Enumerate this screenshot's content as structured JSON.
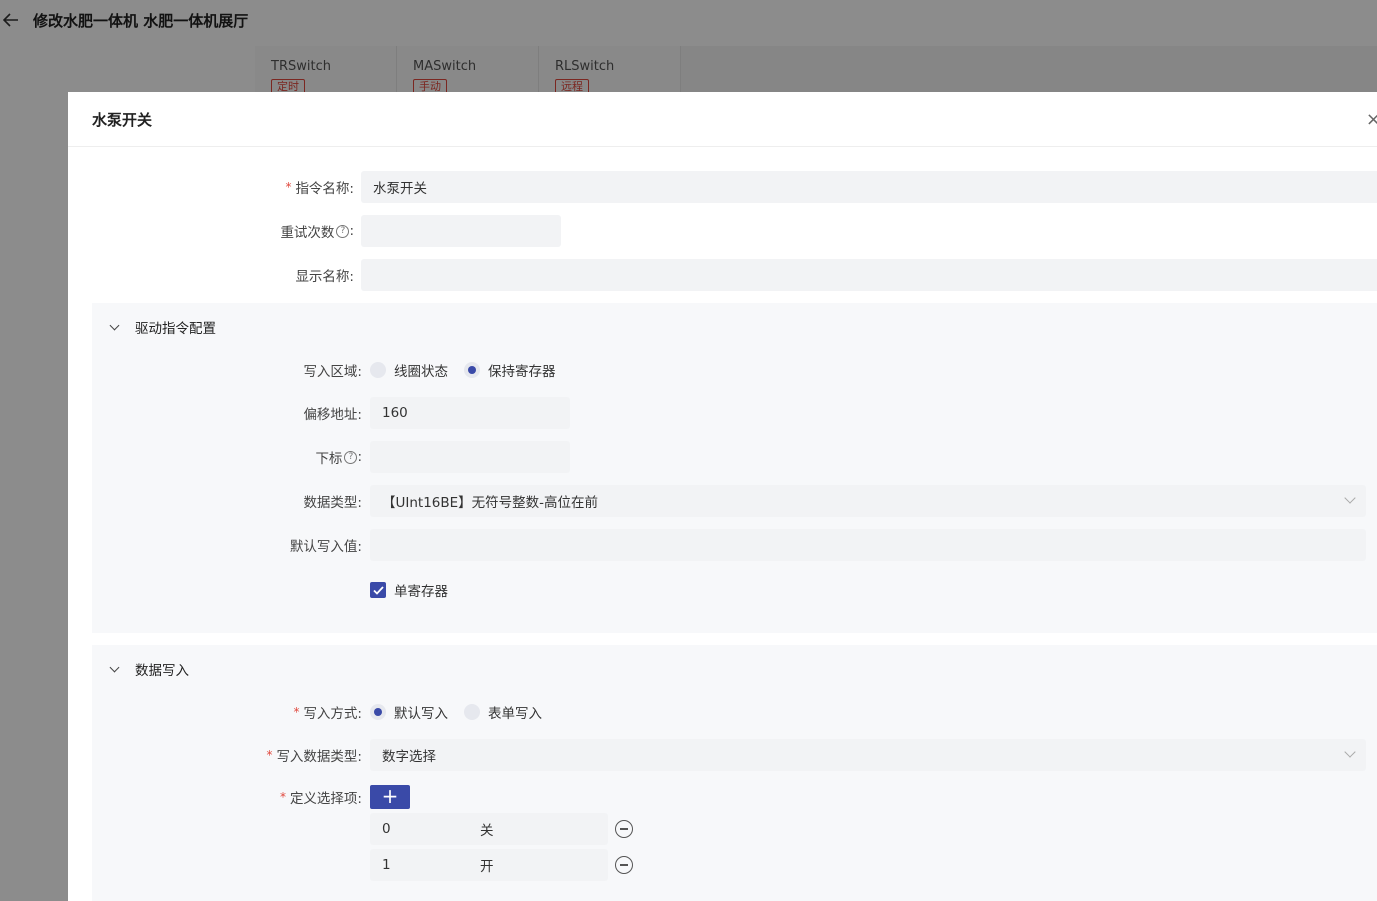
{
  "page": {
    "title": "修改水肥一体机 水肥一体机展厅",
    "tabs": [
      {
        "name": "TRSwitch",
        "tag": "定时"
      },
      {
        "name": "MASwitch",
        "tag": "手动"
      },
      {
        "name": "RLSwitch",
        "tag": "远程"
      }
    ]
  },
  "modal": {
    "title": "水泵开关",
    "close": "×",
    "command_name": {
      "label": "指令名称:",
      "value": "水泵开关"
    },
    "retry_count": {
      "label": "重试次数",
      "colon": ":",
      "value": ""
    },
    "display_name": {
      "label": "显示名称:",
      "value": ""
    }
  },
  "driver_section": {
    "title": "驱动指令配置",
    "write_area": {
      "label": "写入区域:",
      "options": [
        "线圈状态",
        "保持寄存器"
      ],
      "selected": "保持寄存器"
    },
    "offset": {
      "label": "偏移地址:",
      "value": "160"
    },
    "index": {
      "label": "下标",
      "colon": ":",
      "value": ""
    },
    "data_type": {
      "label": "数据类型:",
      "value": "【UInt16BE】无符号整数-高位在前"
    },
    "default_value": {
      "label": "默认写入值:",
      "value": ""
    },
    "single_register": {
      "label": "单寄存器",
      "checked": true
    }
  },
  "write_section": {
    "title": "数据写入",
    "write_mode": {
      "label": "写入方式:",
      "options": [
        "默认写入",
        "表单写入"
      ],
      "selected": "默认写入"
    },
    "write_data_type": {
      "label": "写入数据类型:",
      "value": "数字选择"
    },
    "define_options": {
      "label": "定义选择项:",
      "add": "+",
      "items": [
        {
          "value": "0",
          "text": "关"
        },
        {
          "value": "1",
          "text": "开"
        }
      ]
    }
  },
  "colors": {
    "accent": "#3a4aa8",
    "required": "#e0473c"
  }
}
